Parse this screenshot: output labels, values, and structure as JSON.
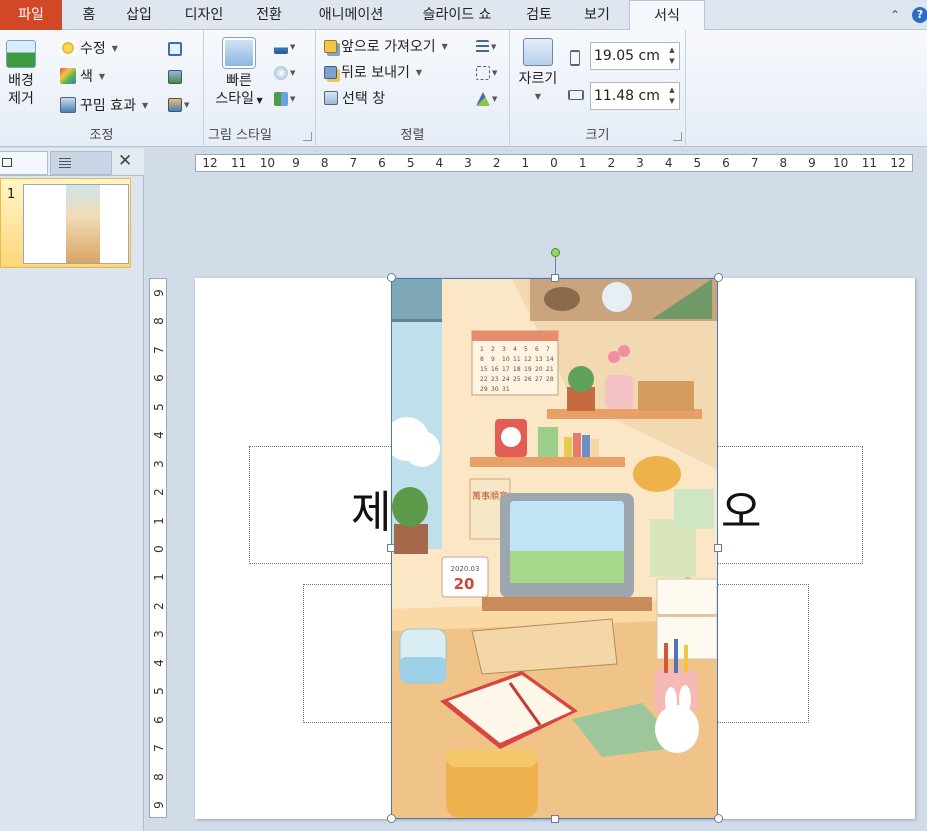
{
  "tabs": [
    {
      "label": "파일",
      "active": false
    },
    {
      "label": "홈",
      "active": false
    },
    {
      "label": "삽입",
      "active": false
    },
    {
      "label": "디자인",
      "active": false
    },
    {
      "label": "전환",
      "active": false
    },
    {
      "label": "애니메이션",
      "active": false
    },
    {
      "label": "슬라이드 쇼",
      "active": false
    },
    {
      "label": "검토",
      "active": false
    },
    {
      "label": "보기",
      "active": false
    },
    {
      "label": "서식",
      "active": true
    }
  ],
  "help_label": "?",
  "ribbon": {
    "adjust": {
      "label": "조정",
      "remove_bg_line1": "배경",
      "remove_bg_line2": "제거",
      "corrections": "수정",
      "color": "색",
      "artistic_effects": "꾸밈 효과"
    },
    "picture_styles": {
      "label": "그림 스타일",
      "quick_styles_line1": "빠른",
      "quick_styles_line2": "스타일"
    },
    "arrange": {
      "label": "정렬",
      "bring_forward": "앞으로 가져오기",
      "send_backward": "뒤로 보내기",
      "selection_pane": "선택 창"
    },
    "size": {
      "label": "크기",
      "crop": "자르기",
      "height_value": "19.05 cm",
      "width_value": "11.48 cm"
    }
  },
  "slides_pane": {
    "close_label": "✕",
    "slides": [
      {
        "number": "1"
      }
    ]
  },
  "ruler": {
    "horizontal": [
      "12",
      "11",
      "10",
      "9",
      "8",
      "7",
      "6",
      "5",
      "4",
      "3",
      "2",
      "1",
      "0",
      "1",
      "2",
      "3",
      "4",
      "5",
      "6",
      "7",
      "8",
      "9",
      "10",
      "11",
      "12"
    ],
    "vertical": [
      "9",
      "8",
      "7",
      "6",
      "5",
      "4",
      "3",
      "2",
      "1",
      "0",
      "1",
      "2",
      "3",
      "4",
      "5",
      "6",
      "7",
      "8",
      "9"
    ]
  },
  "slide": {
    "title_left_fragment": "제",
    "title_right_fragment": "오"
  },
  "picture": {
    "calendar_days": [
      "1",
      "2",
      "3",
      "4",
      "5",
      "6",
      "7",
      "8",
      "9",
      "10",
      "11",
      "12",
      "13",
      "14",
      "15",
      "16",
      "17",
      "18",
      "19",
      "20",
      "21",
      "22",
      "23",
      "24",
      "25",
      "26",
      "27",
      "28",
      "29",
      "30",
      "31"
    ],
    "date_card_year": "2020.03",
    "date_card_day": "20",
    "sign_text": "萬事順意"
  },
  "colors": {
    "file_tab": "#d24726",
    "selection_border": "#4a76b8",
    "rotation_handle": "#8edc5a"
  }
}
